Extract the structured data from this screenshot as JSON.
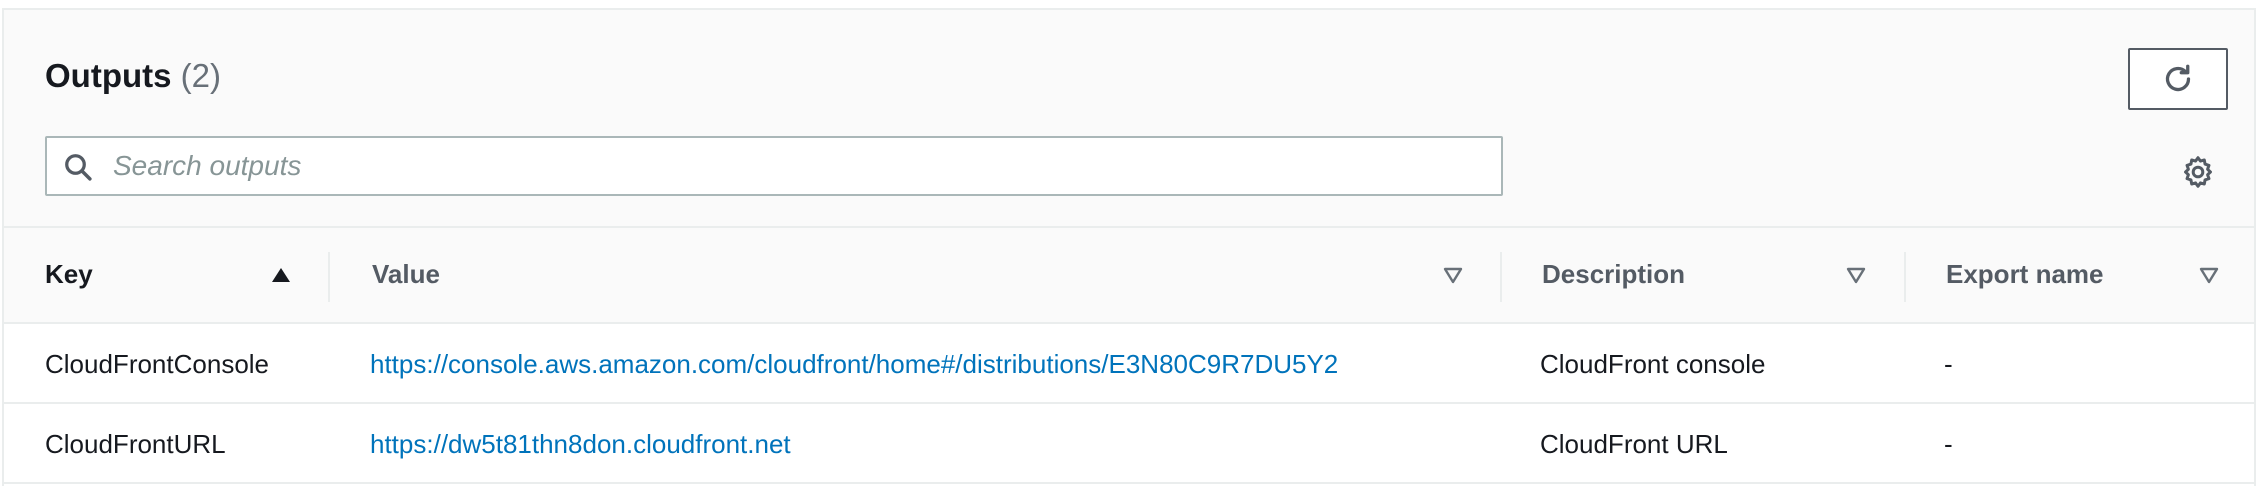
{
  "header": {
    "title": "Outputs",
    "count": "(2)"
  },
  "search": {
    "placeholder": "Search outputs",
    "value": ""
  },
  "icons": {
    "refresh": "refresh-icon",
    "search": "search-icon",
    "settings": "gear-icon",
    "sort_asc": "caret-up-icon",
    "sort_none": "caret-down-outline-icon"
  },
  "colors": {
    "link": "#0073bb",
    "text": "#16191f",
    "header_bg": "#fafafa",
    "border": "#eaeded",
    "secondary_text": "#687078"
  },
  "table": {
    "columns": [
      {
        "label": "Key",
        "sort": "ascending"
      },
      {
        "label": "Value",
        "sort": "none"
      },
      {
        "label": "Description",
        "sort": "none"
      },
      {
        "label": "Export name",
        "sort": "none"
      }
    ],
    "rows": [
      {
        "key": "CloudFrontConsole",
        "value": "https://console.aws.amazon.com/cloudfront/home#/distributions/E3N80C9R7DU5Y2",
        "description": "CloudFront console",
        "export_name": "-"
      },
      {
        "key": "CloudFrontURL",
        "value": "https://dw5t81thn8don.cloudfront.net",
        "description": "CloudFront URL",
        "export_name": "-"
      }
    ]
  }
}
